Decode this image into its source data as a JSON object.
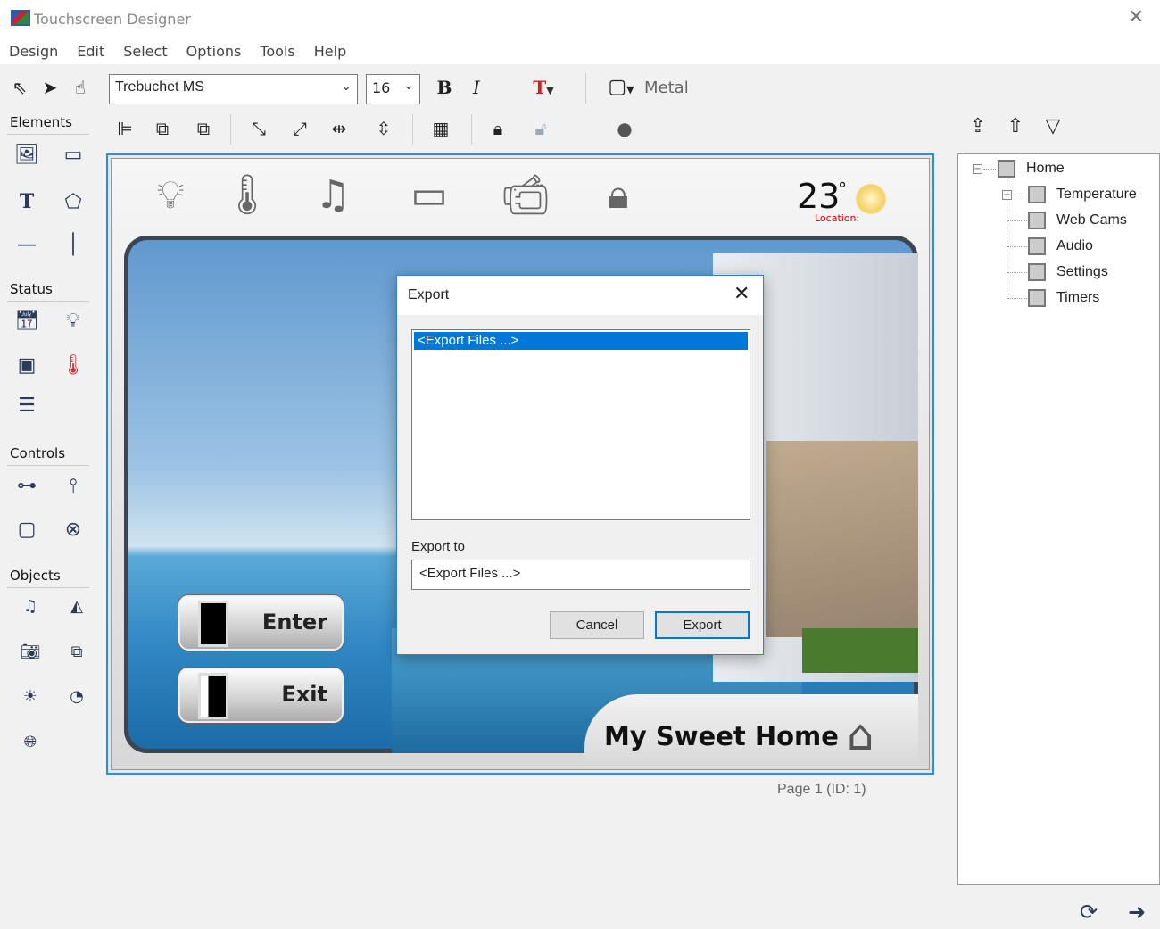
{
  "window": {
    "title": "Touchscreen Designer"
  },
  "menu": [
    "Design",
    "Edit",
    "Select",
    "Options",
    "Tools",
    "Help"
  ],
  "toolbar": {
    "font": "Trebuchet MS",
    "size": "16",
    "bold": "B",
    "italic": "I",
    "text_color": "T",
    "theme": "Metal"
  },
  "palette": {
    "elements": "Elements",
    "status": "Status",
    "controls": "Controls",
    "objects": "Objects"
  },
  "canvas": {
    "temperature": "23",
    "degree": "°",
    "location": "Location:",
    "enter": "Enter",
    "exit": "Exit",
    "brand": "My Sweet Home",
    "page": "Page 1  (ID: 1)"
  },
  "tree": [
    "Home",
    "Temperature",
    "Web Cams",
    "Audio",
    "Settings",
    "Timers"
  ],
  "dialog": {
    "title": "Export",
    "list_item": "<Export Files ...>",
    "export_to_label": "Export to",
    "export_to_value": "<Export Files ...>",
    "cancel": "Cancel",
    "export": "Export"
  }
}
